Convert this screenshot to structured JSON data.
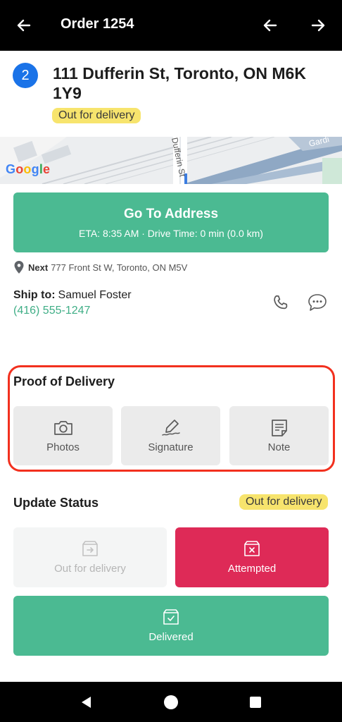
{
  "header": {
    "title": "Order 1254"
  },
  "order": {
    "stop_number": "2",
    "address": "111 Dufferin St, Toronto, ON M6K 1Y9",
    "status": "Out for delivery"
  },
  "map": {
    "street_label": "Dufferin St",
    "road_label": "Gardi",
    "provider": "Google"
  },
  "go_to_address": {
    "label": "Go To Address",
    "eta_text": "ETA: 8:35 AM · Drive Time: 0 min (0.0 km)"
  },
  "next_stop": {
    "label": "Next",
    "address": "777 Front St W, Toronto, ON M5V"
  },
  "recipient": {
    "label": "Ship to:",
    "name": "Samuel Foster",
    "phone": "(416) 555-1247"
  },
  "proof_of_delivery": {
    "title": "Proof of Delivery",
    "buttons": [
      {
        "label": "Photos",
        "icon": "camera-icon"
      },
      {
        "label": "Signature",
        "icon": "signature-pen-icon"
      },
      {
        "label": "Note",
        "icon": "note-icon"
      }
    ]
  },
  "update_status": {
    "title": "Update Status",
    "current_status": "Out for delivery",
    "buttons": {
      "out_for_delivery": "Out for delivery",
      "attempted": "Attempted",
      "delivered": "Delivered"
    }
  },
  "colors": {
    "accent_green": "#4bba92",
    "attempted_red": "#de2a57",
    "status_yellow": "#f7e46d",
    "highlight_red": "#f2301e",
    "stop_blue": "#1a73e8"
  }
}
